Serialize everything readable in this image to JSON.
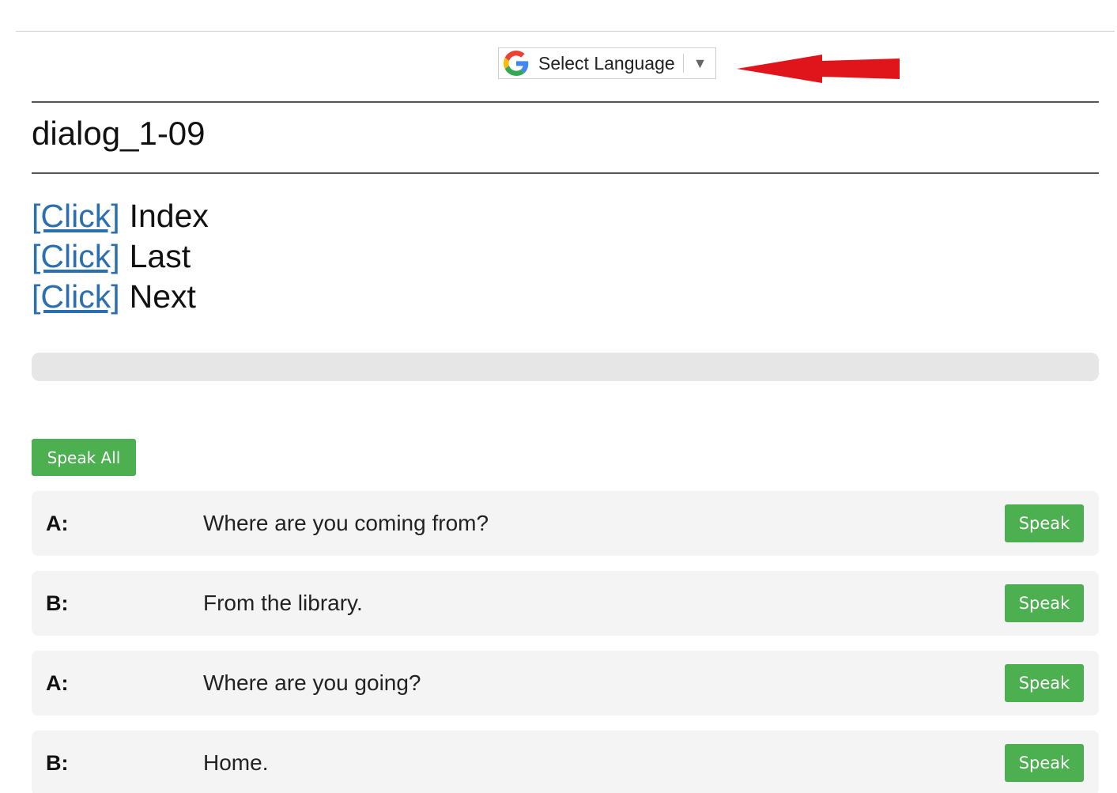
{
  "translate": {
    "label": "Select Language",
    "caret": "▼",
    "logo_icon": "google-g-icon",
    "arrow_icon": "red-arrow-icon",
    "arrow_color": "#e0141b"
  },
  "page": {
    "title": "dialog_1-09"
  },
  "nav": {
    "items": [
      {
        "link": "[Click]",
        "label": "Index"
      },
      {
        "link": "[Click]",
        "label": "Last"
      },
      {
        "link": "[Click]",
        "label": "Next"
      }
    ]
  },
  "progress": {
    "value_percent": 0
  },
  "controls": {
    "speak_all_label": "Speak All"
  },
  "dialog": {
    "speak_label": "Speak",
    "lines": [
      {
        "speaker": "A:",
        "text": "Where are you coming from?"
      },
      {
        "speaker": "B:",
        "text": "From the library."
      },
      {
        "speaker": "A:",
        "text": "Where are you going?"
      },
      {
        "speaker": "B:",
        "text": "Home."
      }
    ]
  },
  "colors": {
    "accent_green": "#4caf50",
    "link_blue": "#2c6fb0",
    "row_background": "#f4f4f4",
    "progress_track": "#e6e6e6"
  }
}
